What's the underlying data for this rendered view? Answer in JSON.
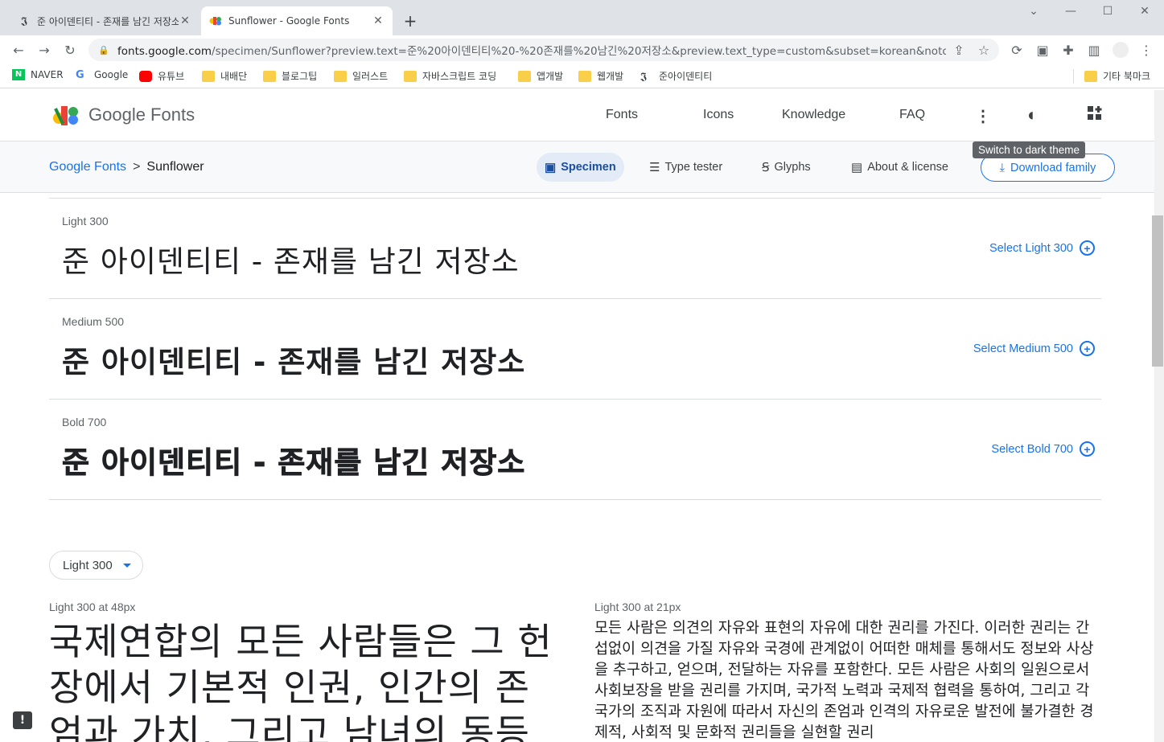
{
  "browser": {
    "tabs": [
      {
        "title": "준 아이덴티티 - 존재를 남긴 저장소",
        "active": false
      },
      {
        "title": "Sunflower - Google Fonts",
        "active": true
      }
    ],
    "url_host": "fonts.google.com",
    "url_path": "/specimen/Sunflower?preview.text=준%20아이덴티티%20-%20존재를%20남긴%20저장소&preview.text_type=custom&subset=korean&noto.scri...",
    "bookmarks": [
      "NAVER",
      "Google",
      "유튜브",
      "내배단",
      "블로그팁",
      "일러스트",
      "자바스크립트 코딩",
      "앱개발",
      "웹개발",
      "준아이덴티티"
    ],
    "other_bookmarks": "기타 북마크"
  },
  "header": {
    "logo_text": "Google Fonts",
    "nav": [
      "Fonts",
      "Icons",
      "Knowledge",
      "FAQ"
    ],
    "tooltip": "Switch to dark theme"
  },
  "subheader": {
    "breadcrumb_home": "Google Fonts",
    "breadcrumb_current": "Sunflower",
    "tabs": [
      "Specimen",
      "Type tester",
      "Glyphs",
      "About & license"
    ],
    "download_label": "Download family"
  },
  "styles": [
    {
      "label": "Light 300",
      "sample": "준 아이덴티티 - 존재를 남긴 저장소",
      "select": "Select Light 300"
    },
    {
      "label": "Medium 500",
      "sample": "준 아이덴티티 - 존재를 남긴 저장소",
      "select": "Select Medium 500"
    },
    {
      "label": "Bold 700",
      "sample": "준 아이덴티티 - 존재를 남긴 저장소",
      "select": "Select Bold 700"
    }
  ],
  "preview": {
    "weight_select": "Light 300",
    "large_label": "Light 300 at 48px",
    "large_text": "국제연합의 모든 사람들은 그 헌장에서 기본적 인권, 인간의 존엄과 가치, 그리고 남녀의 동등한 권",
    "small_label": "Light 300 at 21px",
    "small_text": "모든 사람은 의견의 자유와 표현의 자유에 대한 권리를 가진다. 이러한 권리는 간섭없이 의견을 가질 자유와 국경에 관계없이 어떠한 매체를 통해서도 정보와 사상을 추구하고, 얻으며, 전달하는 자유를 포함한다. 모든 사람은 사회의 일원으로서 사회보장을 받을 권리를 가지며, 국가적 노력과 국제적 협력을 통하여, 그리고 각 국가의 조직과 자원에 따라서 자신의 존엄과 인격의 자유로운 발전에 불가결한 경제적, 사회적 및 문화적 권리들을 실현할 권리"
  },
  "colors": {
    "accent": "#1a73e8",
    "text": "#202124",
    "muted": "#5f6368"
  }
}
